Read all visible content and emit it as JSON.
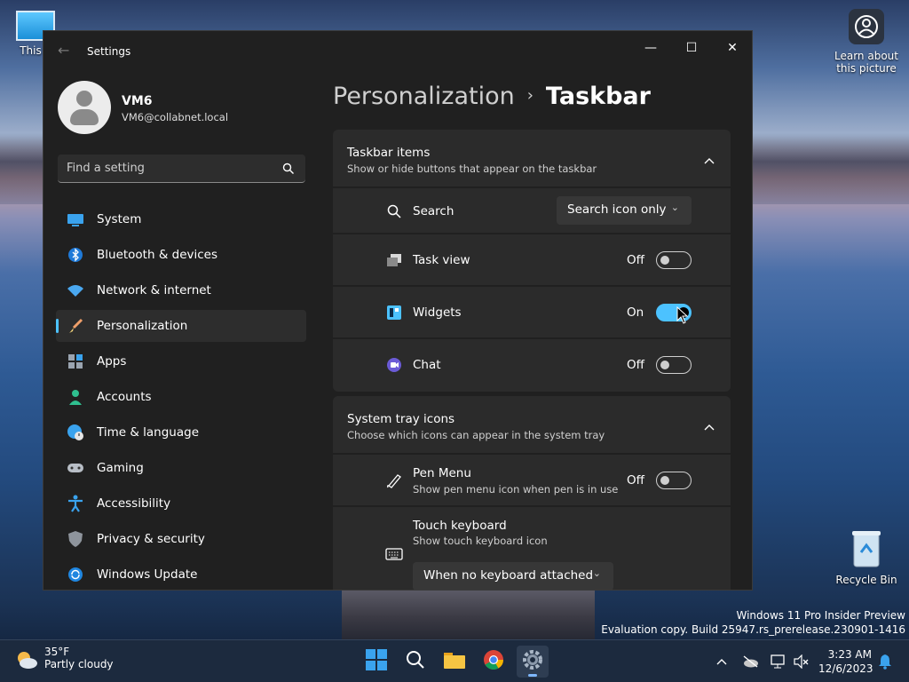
{
  "desktop": {
    "this_pc_label": "This P",
    "learn_label": "Learn about this picture",
    "recycle_label": "Recycle Bin",
    "watermark_line1": "Windows 11 Pro Insider Preview",
    "watermark_line2": "Evaluation copy. Build 25947.rs_prerelease.230901-1416"
  },
  "window": {
    "title": "Settings",
    "controls": {
      "minimize": "—",
      "maximize": "☐",
      "close": "✕"
    }
  },
  "profile": {
    "name": "VM6",
    "email": "VM6@collabnet.local"
  },
  "search": {
    "placeholder": "Find a setting"
  },
  "sidebar": {
    "items": [
      {
        "label": "System",
        "icon": "system-icon"
      },
      {
        "label": "Bluetooth & devices",
        "icon": "bluetooth-icon"
      },
      {
        "label": "Network & internet",
        "icon": "wifi-icon"
      },
      {
        "label": "Personalization",
        "icon": "brush-icon",
        "active": true
      },
      {
        "label": "Apps",
        "icon": "apps-icon"
      },
      {
        "label": "Accounts",
        "icon": "accounts-icon"
      },
      {
        "label": "Time & language",
        "icon": "globe-clock-icon"
      },
      {
        "label": "Gaming",
        "icon": "gamepad-icon"
      },
      {
        "label": "Accessibility",
        "icon": "accessibility-icon"
      },
      {
        "label": "Privacy & security",
        "icon": "shield-icon"
      },
      {
        "label": "Windows Update",
        "icon": "update-icon"
      }
    ]
  },
  "breadcrumb": {
    "parent": "Personalization",
    "separator": "›",
    "current": "Taskbar"
  },
  "taskbar_items": {
    "title": "Taskbar items",
    "subtitle": "Show or hide buttons that appear on the taskbar",
    "search": {
      "label": "Search",
      "dropdown_value": "Search icon only"
    },
    "task_view": {
      "label": "Task view",
      "state": "Off"
    },
    "widgets": {
      "label": "Widgets",
      "state": "On"
    },
    "chat": {
      "label": "Chat",
      "state": "Off"
    }
  },
  "system_tray": {
    "title": "System tray icons",
    "subtitle": "Choose which icons can appear in the system tray",
    "pen_menu": {
      "label": "Pen Menu",
      "sub": "Show pen menu icon when pen is in use",
      "state": "Off"
    },
    "touch_keyboard": {
      "label": "Touch keyboard",
      "sub": "Show touch keyboard icon",
      "dropdown_value": "When no keyboard attached"
    }
  },
  "taskbar": {
    "weather": {
      "temp": "35°F",
      "desc": "Partly cloudy"
    },
    "clock": {
      "time": "3:23 AM",
      "date": "12/6/2023"
    }
  },
  "colors": {
    "accent": "#4cc2ff",
    "window_bg": "#202020",
    "card_bg": "#2b2b2b"
  }
}
